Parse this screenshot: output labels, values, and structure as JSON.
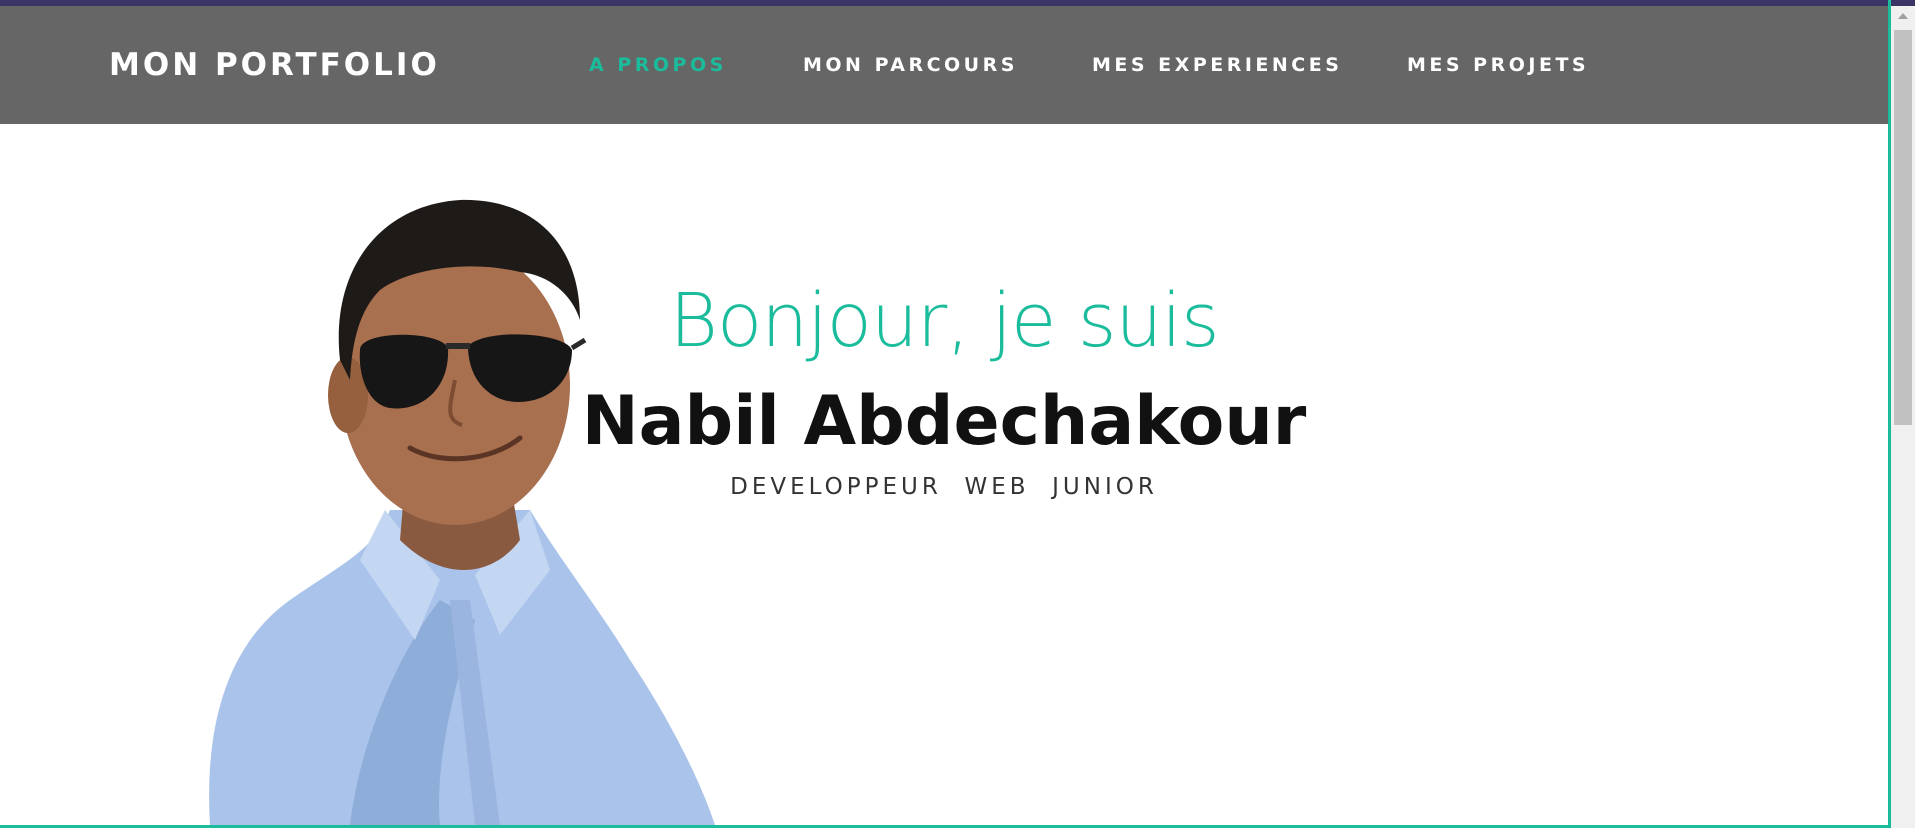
{
  "header": {
    "brand": "MON PORTFOLIO",
    "nav": [
      {
        "label": "A PROPOS",
        "active": true
      },
      {
        "label": "MON PARCOURS",
        "active": false
      },
      {
        "label": "MES EXPERIENCES",
        "active": false
      },
      {
        "label": "MES PROJETS",
        "active": false
      }
    ]
  },
  "hero": {
    "greeting": "Bonjour, je suis",
    "name": "Nabil Abdechakour",
    "subtitle": "DEVELOPPEUR  WEB  JUNIOR",
    "photo_icon": "person-portrait"
  },
  "colors": {
    "accent": "#1abc9c",
    "navbar": "#666666",
    "text": "#111111"
  }
}
